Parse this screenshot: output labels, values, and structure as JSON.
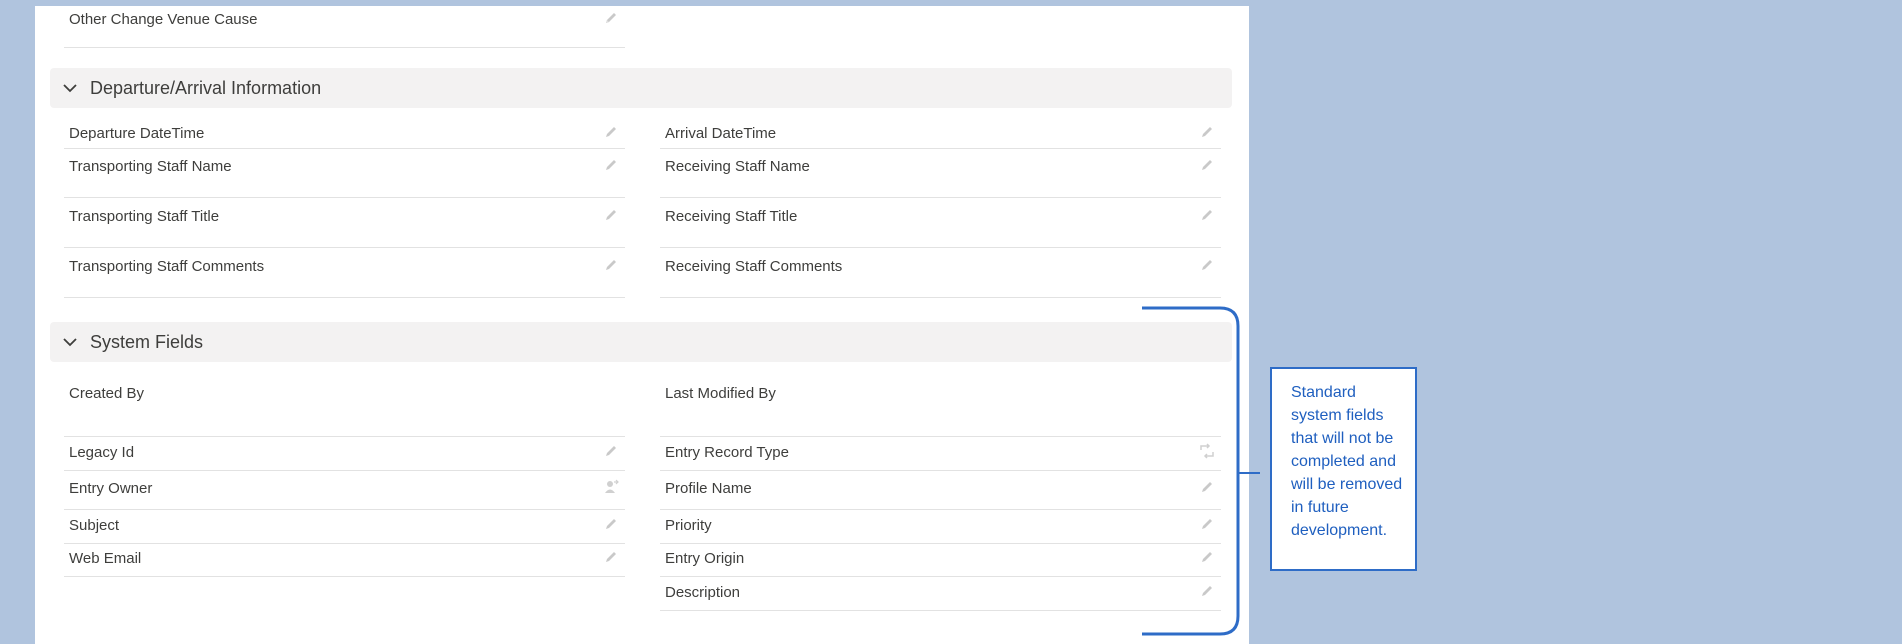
{
  "colors": {
    "page_bg": "#b0c4de",
    "card_bg": "#ffffff",
    "section_bg": "#f3f2f2",
    "callout_border": "#2e6cc7",
    "callout_text": "#1f5fbf"
  },
  "top_field": {
    "label": "Other Change Venue Cause",
    "icon": "pencil-icon"
  },
  "sections": {
    "departure": {
      "title": "Departure/Arrival Information",
      "fields": {
        "departure_datetime": "Departure DateTime",
        "arrival_datetime": "Arrival DateTime",
        "transporting_staff_name": "Transporting Staff Name",
        "receiving_staff_name": "Receiving Staff Name",
        "transporting_staff_title": "Transporting Staff Title",
        "receiving_staff_title": "Receiving Staff Title",
        "transporting_staff_comments": "Transporting Staff Comments",
        "receiving_staff_comments": "Receiving Staff Comments"
      }
    },
    "system": {
      "title": "System Fields",
      "fields": {
        "created_by": "Created By",
        "last_modified_by": "Last Modified By",
        "legacy_id": "Legacy Id",
        "entry_record_type": "Entry Record Type",
        "entry_owner": "Entry Owner",
        "profile_name": "Profile Name",
        "subject": "Subject",
        "priority": "Priority",
        "web_email": "Web Email",
        "entry_origin": "Entry Origin",
        "description": "Description"
      }
    }
  },
  "icons": {
    "section_toggle": "chevron-down-icon",
    "edit": "pencil-icon",
    "change_record_type": "swap-icon",
    "change_owner": "change-owner-icon"
  },
  "annotation": {
    "text": "Standard system fields that will not be completed and will be removed in future development."
  }
}
